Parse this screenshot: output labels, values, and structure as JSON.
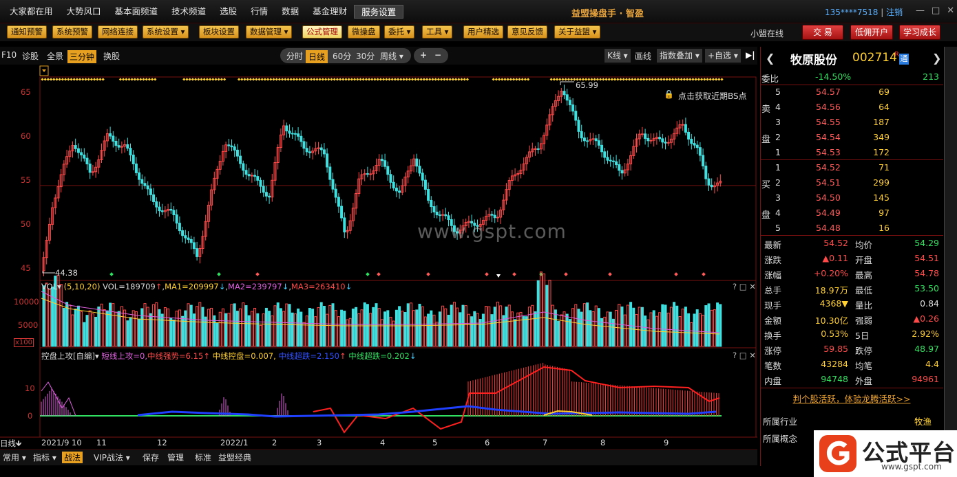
{
  "menu": [
    "大家都在用",
    "大势风口",
    "基本面频道",
    "技术频道",
    "选股",
    "行情",
    "数据",
    "基金理财",
    "服务设置"
  ],
  "app_title": "益盟操盘手 · 智盈",
  "account": {
    "user": "135****7518",
    "logout": "注销"
  },
  "window_buttons": [
    "—",
    "□",
    "✕"
  ],
  "toolbar": [
    "通知预警",
    "系统预警",
    "网络连接",
    "系统设置 ▾",
    "板块设置",
    "数据管理 ▾",
    "公式管理",
    "微操盘",
    "委托 ▾",
    "工具 ▾",
    "用户精选",
    "意见反馈",
    "关于益盟 ▾"
  ],
  "online": "小盟在线",
  "right_buttons": [
    "交 易",
    "低佣开户",
    "学习成长"
  ],
  "chart_controls": {
    "left": [
      "F10",
      "诊股",
      "全景",
      "三分钟",
      "换股"
    ],
    "periods": [
      "分时",
      "日线",
      "60分",
      "30分",
      "周线 ▾"
    ],
    "zoom": [
      "+",
      "−"
    ],
    "kline": "K线 ▾",
    "draw": "画线",
    "index": "指数叠加 ▾",
    "custom": "+自选 ▾"
  },
  "price_axis": [
    "65",
    "60",
    "55",
    "50",
    "45"
  ],
  "annotations": {
    "high": "65.99",
    "low": "44.38",
    "lock": "🔒",
    "bs_text": "点击获取近期BS点",
    "watermark": "www.gspt.com"
  },
  "vol": {
    "name": "VOL▾",
    "params": "(5,10,20)",
    "vol": "VOL=189709",
    "ma1": "MA1=209997",
    "ma2": "MA2=239797",
    "ma3": "MA3=263410",
    "axis": [
      "10000",
      "5000"
    ],
    "unit": "x100"
  },
  "ind": {
    "name": "控盘上攻[自编]▾",
    "s1": "短线上攻=0,",
    "s2": "中线强势=6.15",
    "s3": "中线控盘=0.007,",
    "s4": "中线超跌=2.150",
    "s5": "中线超跌=0.202",
    "axis": [
      "10",
      "0"
    ]
  },
  "xaxis": {
    "label": "日线",
    "months": [
      "2021/9",
      "10",
      "11",
      "12",
      "2022/1",
      "2",
      "3",
      "4",
      "5",
      "6",
      "7",
      "8",
      "9"
    ]
  },
  "bottom": [
    "常用 ▾",
    "指标 ▾",
    "战法",
    "VIP战法 ▾",
    "保存",
    "管理",
    "标准",
    "益盟经典"
  ],
  "stock": {
    "name": "牧原股份",
    "code": "002714",
    "r": "R",
    "tong": "通"
  },
  "weibi": {
    "label": "委比",
    "value": "-14.50%",
    "diff": "213"
  },
  "sell": [
    {
      "lvl": "5",
      "p": "54.57",
      "v": "69"
    },
    {
      "lvl": "4",
      "p": "54.56",
      "v": "64"
    },
    {
      "lvl": "3",
      "p": "54.55",
      "v": "187"
    },
    {
      "lvl": "2",
      "p": "54.54",
      "v": "349"
    },
    {
      "lvl": "1",
      "p": "54.53",
      "v": "172"
    }
  ],
  "buy": [
    {
      "lvl": "1",
      "p": "54.52",
      "v": "71"
    },
    {
      "lvl": "2",
      "p": "54.51",
      "v": "299"
    },
    {
      "lvl": "3",
      "p": "54.50",
      "v": "145"
    },
    {
      "lvl": "4",
      "p": "54.49",
      "v": "97"
    },
    {
      "lvl": "5",
      "p": "54.48",
      "v": "16"
    }
  ],
  "side_labels": {
    "sell": [
      "卖",
      "盘"
    ],
    "buy": [
      "买",
      "盘"
    ]
  },
  "quotes": [
    [
      "最新",
      "54.52",
      "均价",
      "54.29"
    ],
    [
      "涨跌",
      "▲0.11",
      "开盘",
      "54.51"
    ],
    [
      "涨幅",
      "+0.20%",
      "最高",
      "54.78"
    ],
    [
      "总手",
      "18.97万",
      "最低",
      "53.50"
    ],
    [
      "现手",
      "4368▼",
      "量比",
      "0.84"
    ],
    [
      "金额",
      "10.30亿",
      "强弱",
      "▲0.26"
    ],
    [
      "换手",
      "0.53%",
      "5日",
      "2.92%"
    ],
    [
      "涨停",
      "59.85",
      "跌停",
      "48.97"
    ],
    [
      "笔数",
      "43284",
      "均笔",
      "4.4"
    ],
    [
      "内盘",
      "94748",
      "外盘",
      "94961"
    ]
  ],
  "promo": "判个股活跃，体验龙腾活跃>>",
  "industry": {
    "label": "所属行业",
    "value": "牧渔"
  },
  "concept": {
    "label": "所属概念"
  },
  "logo": {
    "text": "公式平台",
    "url": "www.gspt.com"
  },
  "colors": {
    "up": "#ff4a4a",
    "down": "#40e0e0",
    "accent": "#e8a020"
  }
}
